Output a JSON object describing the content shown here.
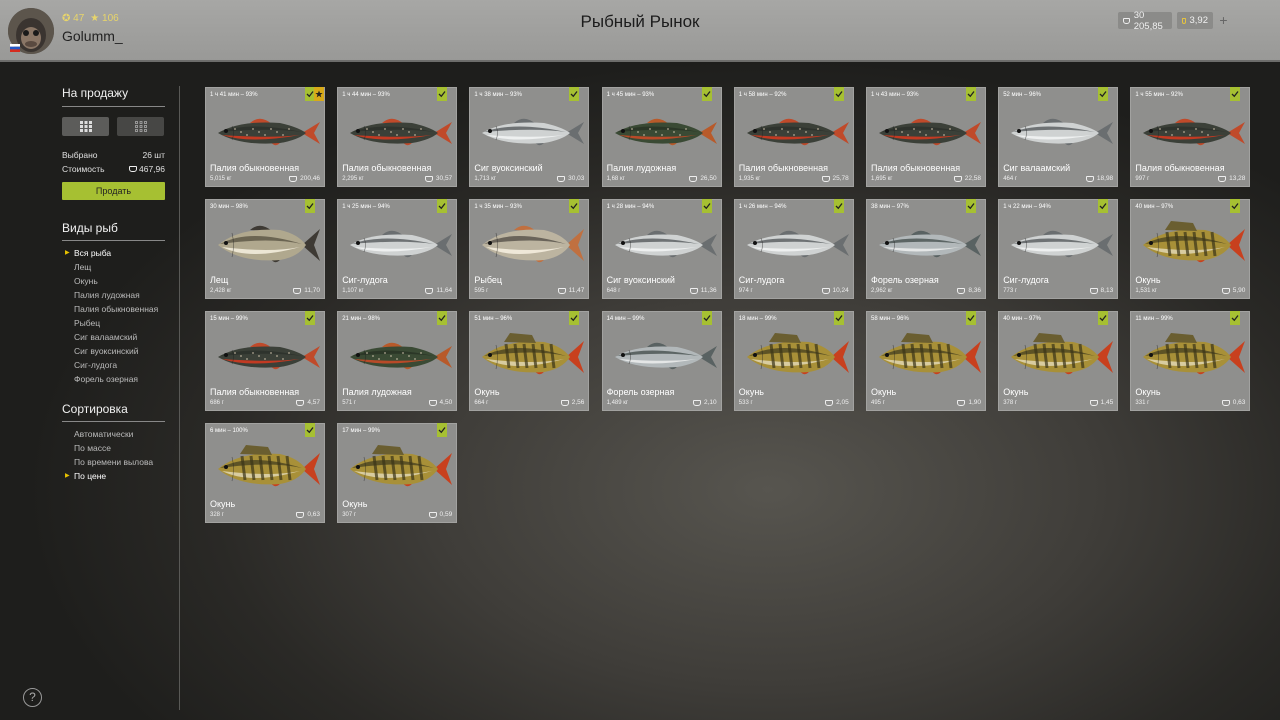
{
  "header": {
    "title": "Рыбный Рынок",
    "username": "Golumm_",
    "level1": "47",
    "level2": "106",
    "silver": "30 205,85",
    "gold": "3,92",
    "add": "+"
  },
  "sidebar": {
    "for_sale_title": "На продажу",
    "selected_label": "Выбрано",
    "selected_value": "26 шт",
    "cost_label": "Стоимость",
    "cost_value": "467,96",
    "sell_button": "Продать",
    "fish_types_title": "Виды рыб",
    "fish_types": [
      "Вся рыба",
      "Лещ",
      "Окунь",
      "Палия лудожная",
      "Палия обыкновенная",
      "Рыбец",
      "Сиг валаамский",
      "Сиг вуоксинский",
      "Сиг-лудога",
      "Форель озерная"
    ],
    "sort_title": "Сортировка",
    "sort_options": [
      "Автоматически",
      "По массе",
      "По времени вылова",
      "По цене"
    ]
  },
  "colors": {
    "accent": "#a6c032",
    "star": "#d8aa18",
    "card": "#8f8f8d"
  },
  "fish": [
    {
      "time": "1 ч 41 мин – 93%",
      "name": "Палия обыкновенная",
      "weight": "5,015 кг",
      "price": "200,46",
      "kind": "char",
      "star": true
    },
    {
      "time": "1 ч 44 мин – 93%",
      "name": "Палия обыкновенная",
      "weight": "2,295 кг",
      "price": "30,57",
      "kind": "char"
    },
    {
      "time": "1 ч 38 мин – 93%",
      "name": "Сиг вуоксинский",
      "weight": "1,713 кг",
      "price": "30,03",
      "kind": "whitefish"
    },
    {
      "time": "1 ч 45 мин – 93%",
      "name": "Палия лудожная",
      "weight": "1,68 кг",
      "price": "26,50",
      "kind": "char2"
    },
    {
      "time": "1 ч 58 мин – 92%",
      "name": "Палия обыкновенная",
      "weight": "1,935 кг",
      "price": "25,78",
      "kind": "char"
    },
    {
      "time": "1 ч 43 мин – 93%",
      "name": "Палия обыкновенная",
      "weight": "1,695 кг",
      "price": "22,58",
      "kind": "char"
    },
    {
      "time": "52 мин – 96%",
      "name": "Сиг валаамский",
      "weight": "464 г",
      "price": "18,98",
      "kind": "whitefish"
    },
    {
      "time": "1 ч 55 мин – 92%",
      "name": "Палия обыкновенная",
      "weight": "997 г",
      "price": "13,28",
      "kind": "char"
    },
    {
      "time": "30 мин – 98%",
      "name": "Лещ",
      "weight": "2,428 кг",
      "price": "11,70",
      "kind": "bream"
    },
    {
      "time": "1 ч 25 мин – 94%",
      "name": "Сиг-лудога",
      "weight": "1,107 кг",
      "price": "11,64",
      "kind": "whitefish"
    },
    {
      "time": "1 ч 35 мин – 93%",
      "name": "Рыбец",
      "weight": "595 г",
      "price": "11,47",
      "kind": "vimba"
    },
    {
      "time": "1 ч 28 мин – 94%",
      "name": "Сиг вуоксинский",
      "weight": "648 г",
      "price": "11,36",
      "kind": "whitefish"
    },
    {
      "time": "1 ч 26 мин – 94%",
      "name": "Сиг-лудога",
      "weight": "974 г",
      "price": "10,24",
      "kind": "whitefish"
    },
    {
      "time": "38 мин – 97%",
      "name": "Форель озерная",
      "weight": "2,962 кг",
      "price": "8,36",
      "kind": "trout"
    },
    {
      "time": "1 ч 22 мин – 94%",
      "name": "Сиг-лудога",
      "weight": "773 г",
      "price": "8,13",
      "kind": "whitefish"
    },
    {
      "time": "40 мин – 97%",
      "name": "Окунь",
      "weight": "1,531 кг",
      "price": "5,90",
      "kind": "perch"
    },
    {
      "time": "15 мин – 99%",
      "name": "Палия обыкновенная",
      "weight": "686 г",
      "price": "4,57",
      "kind": "char"
    },
    {
      "time": "21 мин – 98%",
      "name": "Палия лудожная",
      "weight": "571 г",
      "price": "4,50",
      "kind": "char2"
    },
    {
      "time": "51 мин – 96%",
      "name": "Окунь",
      "weight": "664 г",
      "price": "2,56",
      "kind": "perch"
    },
    {
      "time": "14 мин – 99%",
      "name": "Форель озерная",
      "weight": "1,489 кг",
      "price": "2,10",
      "kind": "trout"
    },
    {
      "time": "18 мин – 99%",
      "name": "Окунь",
      "weight": "533 г",
      "price": "2,05",
      "kind": "perch"
    },
    {
      "time": "58 мин – 96%",
      "name": "Окунь",
      "weight": "495 г",
      "price": "1,90",
      "kind": "perch"
    },
    {
      "time": "40 мин – 97%",
      "name": "Окунь",
      "weight": "378 г",
      "price": "1,45",
      "kind": "perch"
    },
    {
      "time": "11 мин – 99%",
      "name": "Окунь",
      "weight": "331 г",
      "price": "0,63",
      "kind": "perch"
    },
    {
      "time": "6 мин – 100%",
      "name": "Окунь",
      "weight": "328 г",
      "price": "0,63",
      "kind": "perch"
    },
    {
      "time": "17 мин – 99%",
      "name": "Окунь",
      "weight": "307 г",
      "price": "0,59",
      "kind": "perch"
    }
  ]
}
